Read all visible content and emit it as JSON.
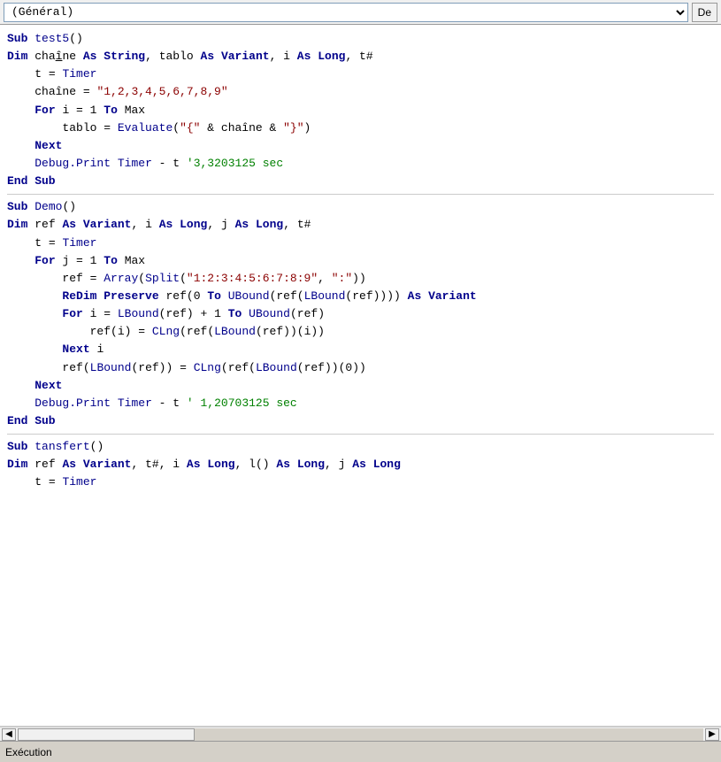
{
  "topbar": {
    "select_value": "(Général)",
    "btn_label": "De"
  },
  "bottom_bar": {
    "label": "Exécution"
  },
  "code": {
    "blocks": [
      {
        "id": "test5",
        "lines": [
          {
            "text": "Sub test5()",
            "type": "normal"
          },
          {
            "text": "Dim chaîne As String, tablo As Variant, i As Long, t#",
            "type": "normal"
          },
          {
            "text": "    t = Timer",
            "type": "normal"
          },
          {
            "text": "    chaîne = \"1,2,3,4,5,6,7,8,9\"",
            "type": "normal"
          },
          {
            "text": "    For i = 1 To Max",
            "type": "normal"
          },
          {
            "text": "        tablo = Evaluate(\"{\" & chaîne & \"}\")",
            "type": "normal"
          },
          {
            "text": "    Next",
            "type": "normal"
          },
          {
            "text": "    Debug.Print Timer - t '3,3203125 sec",
            "type": "normal"
          },
          {
            "text": "End Sub",
            "type": "normal"
          }
        ]
      },
      {
        "id": "demo",
        "lines": [
          {
            "text": "Sub Demo()",
            "type": "normal"
          },
          {
            "text": "Dim ref As Variant, i As Long, j As Long, t#",
            "type": "normal"
          },
          {
            "text": "    t = Timer",
            "type": "normal"
          },
          {
            "text": "    For j = 1 To Max",
            "type": "normal"
          },
          {
            "text": "        ref = Array(Split(\"1:2:3:4:5:6:7:8:9\", \":\"))",
            "type": "normal"
          },
          {
            "text": "        ReDim Preserve ref(0 To UBound(ref(LBound(ref)))) As Variant",
            "type": "normal"
          },
          {
            "text": "        For i = LBound(ref) + 1 To UBound(ref)",
            "type": "normal"
          },
          {
            "text": "            ref(i) = CLng(ref(LBound(ref))(i))",
            "type": "normal"
          },
          {
            "text": "        Next i",
            "type": "normal"
          },
          {
            "text": "        ref(LBound(ref)) = CLng(ref(LBound(ref))(0))",
            "type": "normal"
          },
          {
            "text": "    Next",
            "type": "normal"
          },
          {
            "text": "    Debug.Print Timer - t ' 1,20703125 sec",
            "type": "normal"
          },
          {
            "text": "End Sub",
            "type": "normal"
          }
        ]
      },
      {
        "id": "tansfert",
        "lines": [
          {
            "text": "Sub tansfert()",
            "type": "normal"
          },
          {
            "text": "Dim ref As Variant, t#, i As Long, l() As Long, j As Long",
            "type": "normal"
          },
          {
            "text": "    t = Timer",
            "type": "normal"
          }
        ]
      }
    ]
  }
}
